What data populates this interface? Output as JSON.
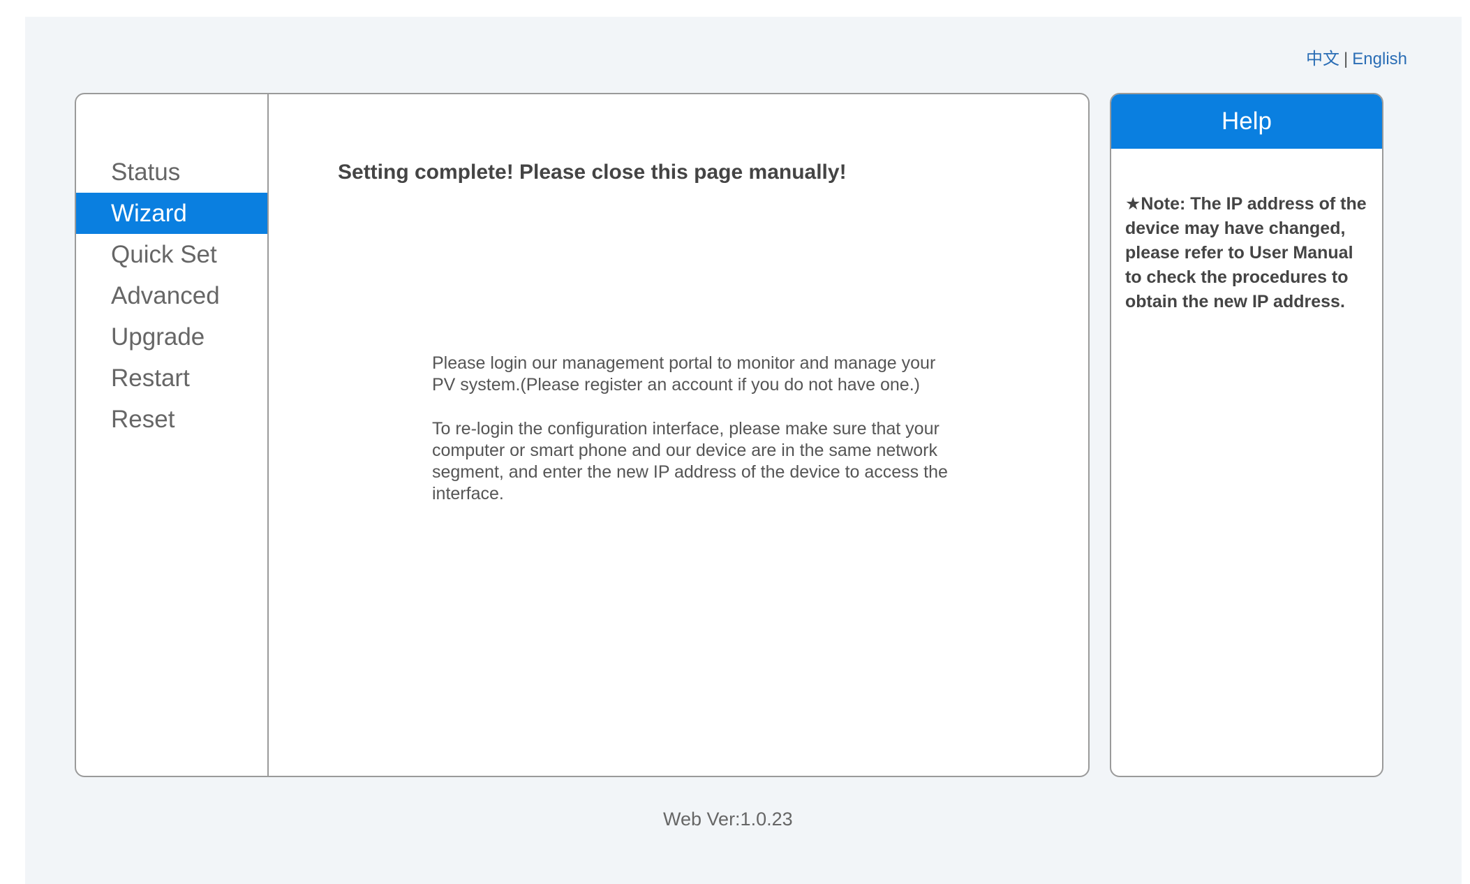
{
  "language": {
    "chinese": "中文",
    "separator": "|",
    "english": "English"
  },
  "sidebar": {
    "items": [
      {
        "label": "Status"
      },
      {
        "label": "Wizard"
      },
      {
        "label": "Quick Set"
      },
      {
        "label": "Advanced"
      },
      {
        "label": "Upgrade"
      },
      {
        "label": "Restart"
      },
      {
        "label": "Reset"
      }
    ],
    "active": "Wizard"
  },
  "content": {
    "title": "Setting complete! Please close this page manually!",
    "paragraph1": "Please login our management portal to monitor and manage your PV system.(Please register an account if you do not have one.)",
    "paragraph2": "To re-login the configuration interface, please make sure that your computer or smart phone and our device are in the same network segment, and enter the new IP address of the device to access the interface."
  },
  "help": {
    "title": "Help",
    "note": "★Note: The IP address of the device may have changed, please refer to User Manual to check the procedures to obtain the new IP address."
  },
  "footer": {
    "version": "Web Ver:1.0.23"
  },
  "colors": {
    "accent": "#0a7fe0",
    "background": "#f2f5f8",
    "border": "#9a9a9a"
  }
}
